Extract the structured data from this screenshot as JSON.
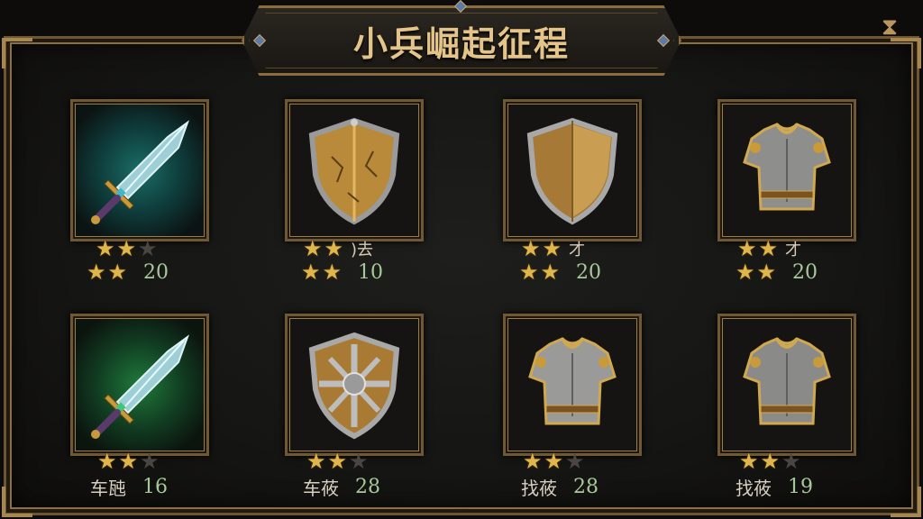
{
  "title": "小兵崛起征程",
  "close_icon": "hourglass-close-icon",
  "colors": {
    "gold": "#e4c488",
    "star_on": "#e0b54a",
    "star_off": "#4a4540",
    "count": "#a7c99a"
  },
  "items": [
    {
      "icon": "sword-icon",
      "rating": 2,
      "row1_text": "",
      "row2_stars": 2,
      "count": "20"
    },
    {
      "icon": "cracked-shield-icon",
      "rating": 2,
      "row1_text": ")去",
      "row2_stars": 2,
      "count": "10"
    },
    {
      "icon": "shield-icon",
      "rating": 2,
      "row1_text": "才",
      "row2_stars": 2,
      "count": "20"
    },
    {
      "icon": "chest-armor-icon",
      "rating": 2,
      "row1_text": "才",
      "row2_stars": 2,
      "count": "20"
    },
    {
      "icon": "sword-icon",
      "rating": 2,
      "label": "车瓲",
      "count": "16"
    },
    {
      "icon": "boss-shield-icon",
      "rating": 2,
      "label": "车莜",
      "count": "28"
    },
    {
      "icon": "chest-armor-icon",
      "rating": 2,
      "label": "找莜",
      "count": "28"
    },
    {
      "icon": "chest-armor-icon",
      "rating": 2,
      "label": "找莜",
      "count": "19"
    }
  ]
}
